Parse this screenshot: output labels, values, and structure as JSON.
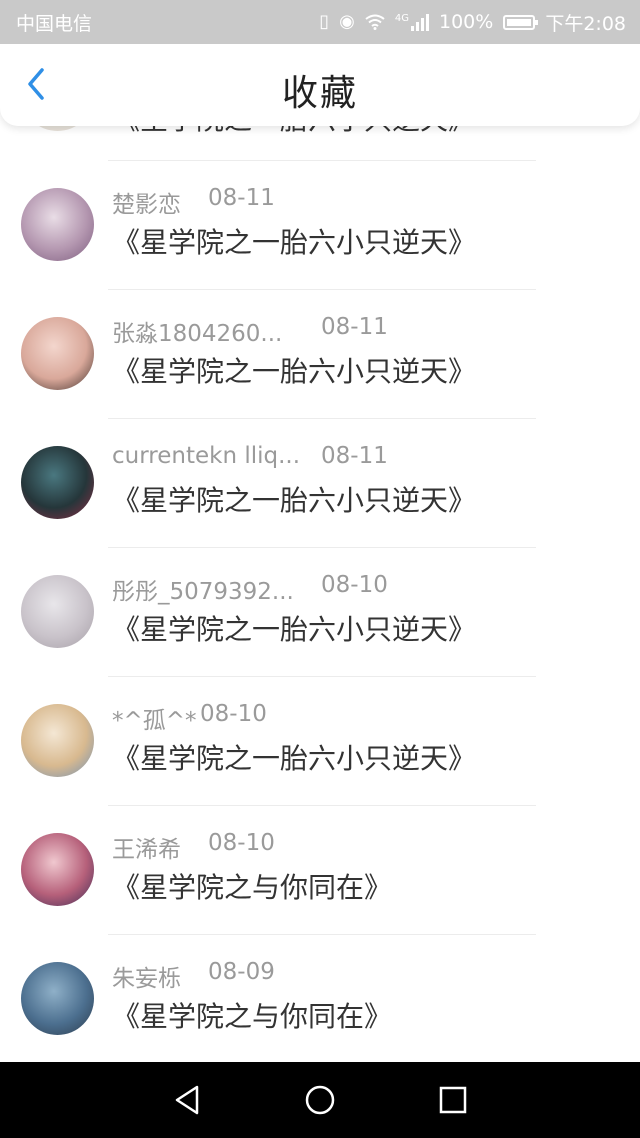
{
  "status_bar": {
    "carrier": "中国电信",
    "network": "4G",
    "battery": "100%",
    "time": "下午2:08"
  },
  "header": {
    "title": "收藏"
  },
  "partial_item": {
    "book": "《星学院之一胎六小只逆天》"
  },
  "items": [
    {
      "user": "楚影恋",
      "date": "08-11",
      "book": "《星学院之一胎六小只逆天》",
      "avatar_colors": [
        "#e9dde6",
        "#b497b0",
        "#7b5b7d"
      ]
    },
    {
      "user": "张淼1804260...",
      "date": "08-11",
      "book": "《星学院之一胎六小只逆天》",
      "avatar_colors": [
        "#f3d6cd",
        "#d9a89a",
        "#3a2b27"
      ]
    },
    {
      "user": "currentekn lliq...",
      "date": "08-11",
      "book": "《星学院之一胎六小只逆天》",
      "avatar_colors": [
        "#4a7880",
        "#25363a",
        "#8e2d44"
      ]
    },
    {
      "user": "彤彤_5079392...",
      "date": "08-10",
      "book": "《星学院之一胎六小只逆天》",
      "avatar_colors": [
        "#e8e6ea",
        "#c9c3ca",
        "#a59ea6"
      ]
    },
    {
      "user": "*^孤^*",
      "date": "08-10",
      "book": "《星学院之一胎六小只逆天》",
      "avatar_colors": [
        "#f4e7d4",
        "#d8b98f",
        "#6e8fb6"
      ]
    },
    {
      "user": "王浠希",
      "date": "08-10",
      "book": "《星学院之与你同在》",
      "avatar_colors": [
        "#f0c8cf",
        "#b6607a",
        "#3b2a55"
      ]
    },
    {
      "user": "朱妄栎",
      "date": "08-09",
      "book": "《星学院之与你同在》",
      "avatar_colors": [
        "#8fb0c8",
        "#4c6f8f",
        "#2b3a4b"
      ]
    }
  ],
  "theme": {
    "accent": "#2f8fe6",
    "status_bar_bg": "#c9c9c9"
  },
  "icons": {
    "back": "chevron-left-icon",
    "nav_back": "triangle-back-icon",
    "nav_home": "circle-home-icon",
    "nav_recents": "square-recents-icon"
  }
}
